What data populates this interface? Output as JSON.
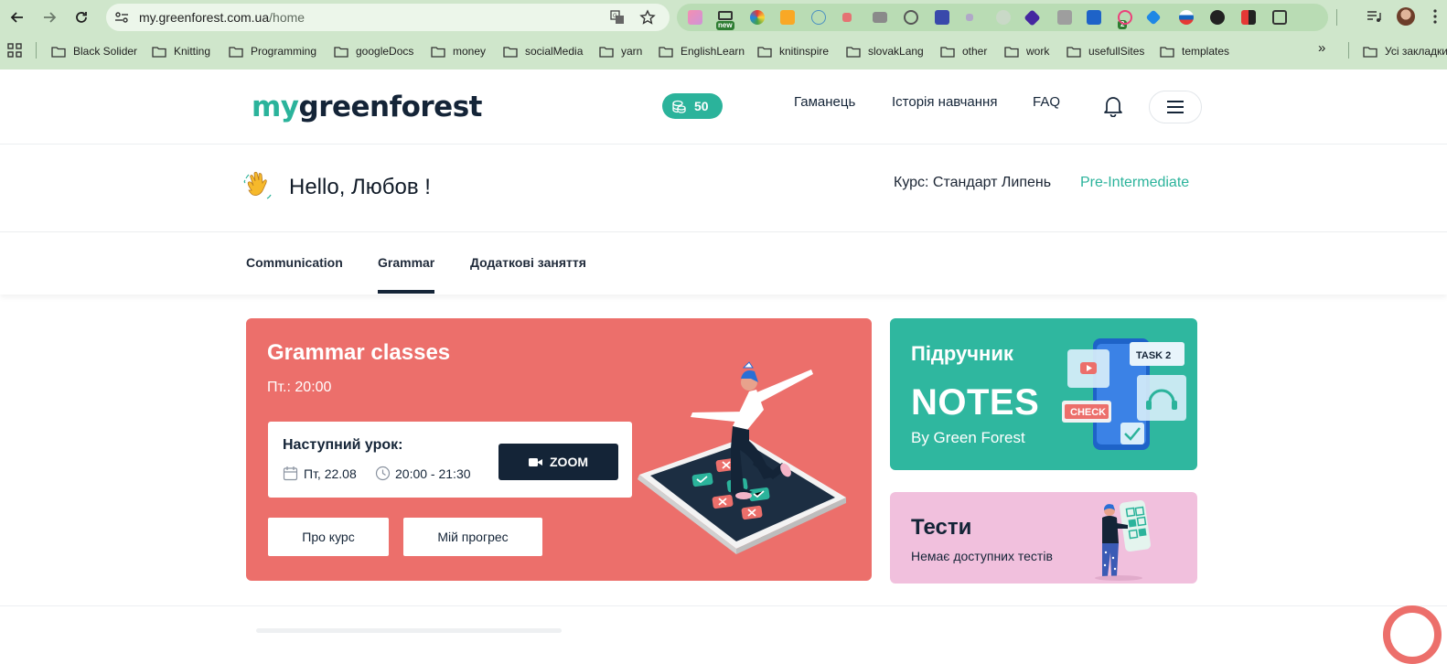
{
  "browser": {
    "url_domain": "my.greenforest.com.ua",
    "url_path": "/home",
    "extension_badge_new": "new",
    "extension_badge_count": "2",
    "bookmarks": [
      {
        "label": "Black Solider"
      },
      {
        "label": "Knitting"
      },
      {
        "label": "Programming"
      },
      {
        "label": "googleDocs"
      },
      {
        "label": "money"
      },
      {
        "label": "socialMedia"
      },
      {
        "label": "yarn"
      },
      {
        "label": "EnglishLearn"
      },
      {
        "label": "knitinspire"
      },
      {
        "label": "slovakLang"
      },
      {
        "label": "other"
      },
      {
        "label": "work"
      },
      {
        "label": "usefullSites"
      },
      {
        "label": "templates"
      }
    ],
    "bookmarks_more": "»",
    "all_bookmarks": "Усі закладки"
  },
  "header": {
    "logo_my": "my",
    "logo_rest": "greenforest",
    "coins": "50",
    "nav": [
      {
        "label": "Гаманець"
      },
      {
        "label": "Історія навчання"
      },
      {
        "label": "FAQ"
      }
    ]
  },
  "greeting": {
    "hello": "Hello, Любов !",
    "course_label": "Курс: Стандарт Липень",
    "course_level": "Pre-Intermediate"
  },
  "tabs": [
    {
      "label": "Communication"
    },
    {
      "label": "Grammar"
    },
    {
      "label": "Додаткові заняття"
    }
  ],
  "active_tab": "Grammar",
  "grammar_card": {
    "title": "Grammar classes",
    "schedule": "Пт.: 20:00",
    "next_title": "Наступний урок:",
    "next_date": "Пт, 22.08",
    "next_hours": "20:00 - 21:30",
    "zoom_label": "ZOOM",
    "about_label": "Про курс",
    "progress_label": "Мій прогрес"
  },
  "notes_card": {
    "label": "Підручник",
    "title": "NOTES",
    "subtitle": "By Green Forest",
    "illus_task": "TASK 2",
    "illus_check": "CHECK"
  },
  "tests_card": {
    "title": "Тести",
    "subtitle": "Немає доступних тестів"
  },
  "colors": {
    "brand_green": "#2bb39b",
    "brand_dark": "#142437",
    "grammar_red": "#ec6f6b",
    "tests_pink": "#f1c0dd",
    "chrome_green": "#cfe6cb"
  }
}
